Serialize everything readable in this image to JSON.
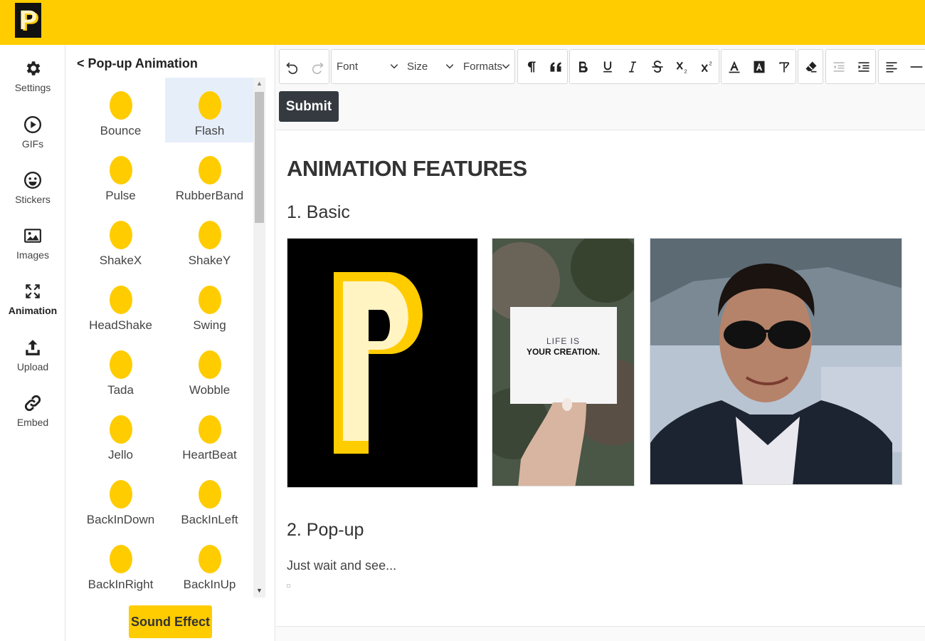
{
  "brand": {
    "logo_letter": "P",
    "accent": "#ffcc00"
  },
  "rail": {
    "items": [
      {
        "label": "Settings",
        "icon": "gear-icon"
      },
      {
        "label": "GIFs",
        "icon": "play-icon"
      },
      {
        "label": "Stickers",
        "icon": "smiley-icon"
      },
      {
        "label": "Images",
        "icon": "image-icon"
      },
      {
        "label": "Animation",
        "icon": "arrows-expand-icon",
        "active": true
      },
      {
        "label": "Upload",
        "icon": "upload-icon"
      },
      {
        "label": "Embed",
        "icon": "link-icon"
      }
    ]
  },
  "panel": {
    "title": "< Pop-up Animation",
    "animations": [
      "Bounce",
      "Flash",
      "Pulse",
      "RubberBand",
      "ShakeX",
      "ShakeY",
      "HeadShake",
      "Swing",
      "Tada",
      "Wobble",
      "Jello",
      "HeartBeat",
      "BackInDown",
      "BackInLeft",
      "BackInRight",
      "BackInUp"
    ],
    "selected": "Flash",
    "sound_button": "Sound Effect"
  },
  "toolbar": {
    "font_label": "Font",
    "size_label": "Size",
    "formats_label": "Formats",
    "submit_label": "Submit"
  },
  "document": {
    "heading": "ANIMATION FEATURES",
    "section1": "1. Basic",
    "section2": "2. Pop-up",
    "paragraph": "Just wait and see...",
    "card_line1": "LIFE IS",
    "card_line2": "YOUR CREATION."
  }
}
